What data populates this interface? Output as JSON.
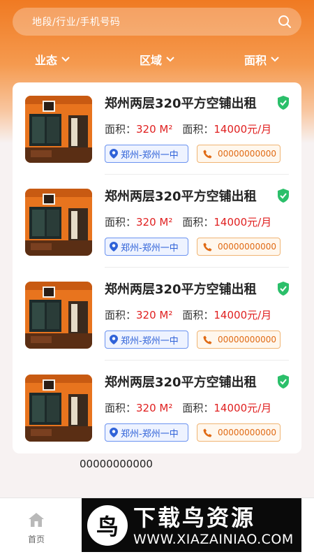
{
  "search": {
    "placeholder": "地段/行业/手机号码"
  },
  "filters": [
    {
      "label": "业态"
    },
    {
      "label": "区域"
    },
    {
      "label": "面积"
    }
  ],
  "listings": [
    {
      "title": "郑州两层320平方空铺出租",
      "area_label": "面积：",
      "area_value": "320 M²",
      "price_label": "面积：",
      "price_value": "14000元/月",
      "location": "郑州-郑州一中",
      "phone": "00000000000"
    },
    {
      "title": "郑州两层320平方空铺出租",
      "area_label": "面积：",
      "area_value": "320 M²",
      "price_label": "面积：",
      "price_value": "14000元/月",
      "location": "郑州-郑州一中",
      "phone": "00000000000"
    },
    {
      "title": "郑州两层320平方空铺出租",
      "area_label": "面积：",
      "area_value": "320 M²",
      "price_label": "面积：",
      "price_value": "14000元/月",
      "location": "郑州-郑州一中",
      "phone": "00000000000"
    },
    {
      "title": "郑州两层320平方空铺出租",
      "area_label": "面积：",
      "area_value": "320 M²",
      "price_label": "面积：",
      "price_value": "14000元/月",
      "location": "郑州-郑州一中",
      "phone": "00000000000"
    }
  ],
  "footer_phone": "00000000000",
  "tabbar": {
    "home_label": "首页"
  },
  "watermark": {
    "title": "下载鸟资源",
    "url": "WWW.XIAZAINIAO.COM"
  },
  "colors": {
    "brand": "#f07a22",
    "price": "#e02020",
    "location": "#2f62d8",
    "phone": "#e06a14",
    "verified": "#2bbf6a"
  },
  "icons": {
    "search": "search-icon",
    "filter_arrow": "chevron-down-icon",
    "verified": "shield-check-icon",
    "location": "location-pin-icon",
    "phone": "phone-icon",
    "home": "home-icon"
  }
}
